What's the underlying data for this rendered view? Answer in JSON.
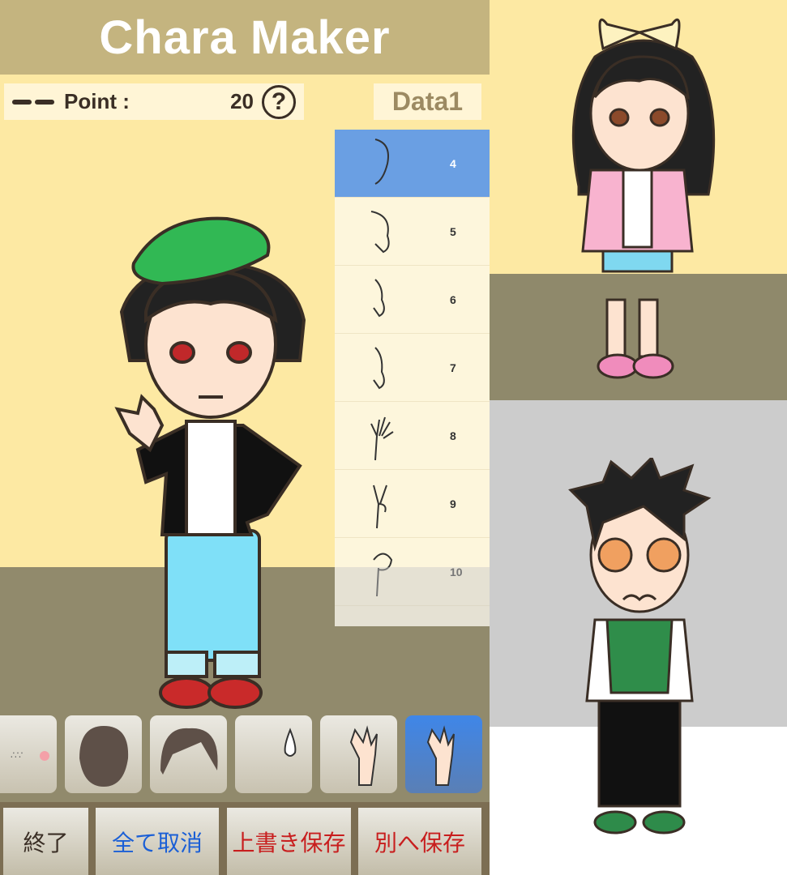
{
  "header": {
    "title": "Chara Maker"
  },
  "status": {
    "point_label": "Point :",
    "point_value": "20",
    "help_icon": "question-circle-icon",
    "data_slot": "Data1"
  },
  "parts_list": {
    "items": [
      {
        "num": "4",
        "selected": true
      },
      {
        "num": "5"
      },
      {
        "num": "6"
      },
      {
        "num": "7"
      },
      {
        "num": "8"
      },
      {
        "num": "9"
      },
      {
        "num": "10"
      }
    ]
  },
  "part_categories": [
    "blush",
    "back-hair",
    "bangs",
    "sweat-drop",
    "hand",
    "hand-selected"
  ],
  "buttons": {
    "quit": "終了",
    "cancel_all": "全て取消",
    "overwrite_save": "上書き保存",
    "save_as": "別へ保存"
  },
  "colors": {
    "header": "#c4b47f",
    "background": "#fde9a3",
    "floor": "#918a6c",
    "selected": "#6a9fe3",
    "cancel_text": "#1a5fd6",
    "save_text": "#c81e1e"
  }
}
